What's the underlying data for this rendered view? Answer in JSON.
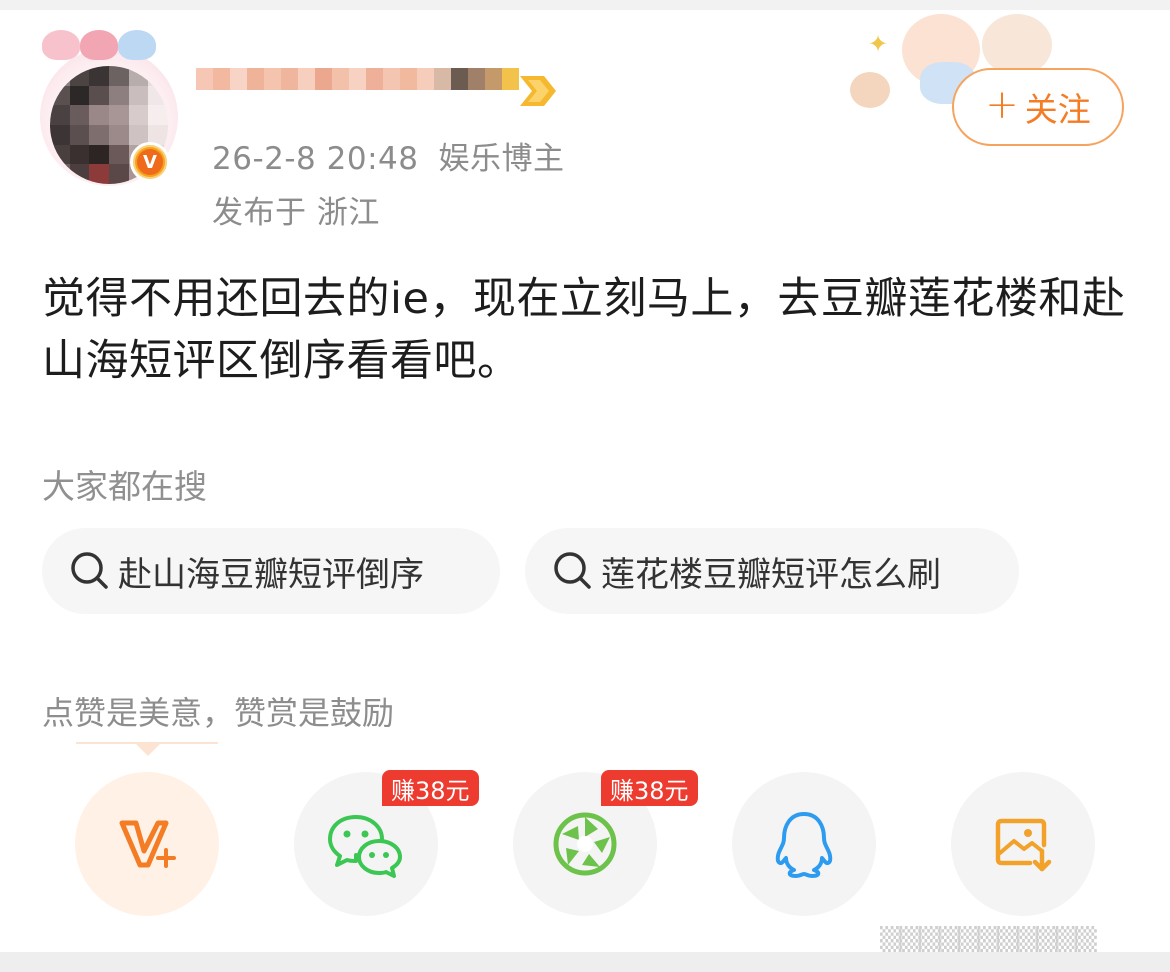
{
  "post": {
    "time": "26-2-8 20:48",
    "role": "娱乐博主",
    "location": "发布于 浙江",
    "follow_label": "关注",
    "follow_plus": "+",
    "text": "觉得不用还回去的ie，现在立刻马上，去豆瓣莲花楼和赴山海短评区倒序看看吧。",
    "verified_badge": "V"
  },
  "search": {
    "title": "大家都在搜",
    "chips": [
      {
        "label": "赴山海豆瓣短评倒序",
        "icon": "search-icon"
      },
      {
        "label": "莲花楼豆瓣短评怎么刷",
        "icon": "search-icon"
      }
    ]
  },
  "reward": {
    "title": "点赞是美意，赞赏是鼓励"
  },
  "share": {
    "buttons": [
      {
        "name": "v-plus",
        "icon": "v-plus-icon"
      },
      {
        "name": "wechat",
        "icon": "wechat-icon",
        "badge": "赚38元"
      },
      {
        "name": "moments",
        "icon": "moments-icon",
        "badge": "赚38元"
      },
      {
        "name": "qq",
        "icon": "qq-icon"
      },
      {
        "name": "save-image",
        "icon": "save-image-icon"
      }
    ]
  },
  "colors": {
    "accent": "#f37c24",
    "badge_red": "#ee3b2f",
    "wechat_green": "#3cc654",
    "qq_blue": "#2d9cf0",
    "save_orange": "#f2a12a"
  }
}
